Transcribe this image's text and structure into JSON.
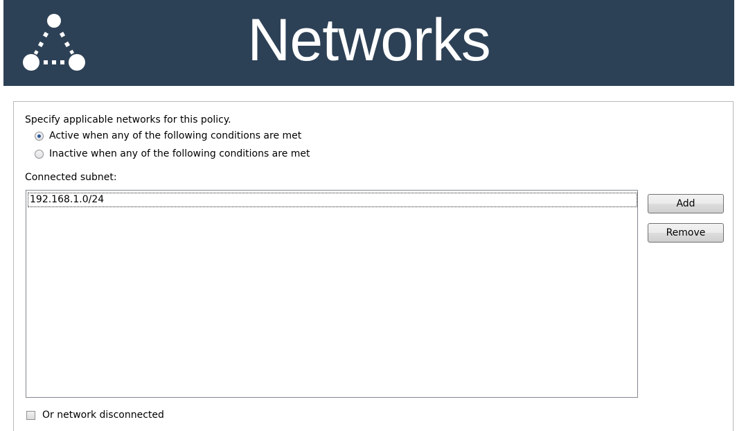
{
  "header": {
    "title": "Networks",
    "icon": "network-triangle-icon",
    "background_color": "#2d4156"
  },
  "panel": {
    "description": "Specify applicable networks for this policy.",
    "radios": [
      {
        "label": "Active when any of the following conditions are met",
        "checked": true
      },
      {
        "label": "Inactive when any of the following conditions are met",
        "checked": false
      }
    ],
    "subnet_label": "Connected subnet:",
    "subnets": [
      "192.168.1.0/24"
    ],
    "add_label": "Add",
    "remove_label": "Remove",
    "disconnected_label": "Or network disconnected",
    "disconnected_checked": false
  }
}
